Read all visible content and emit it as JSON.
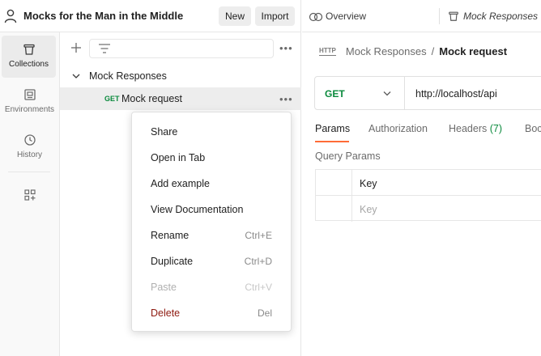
{
  "workspace": {
    "title": "Mocks for the Man in the Middle",
    "new_label": "New",
    "import_label": "Import"
  },
  "rail": {
    "items": [
      {
        "label": "Collections",
        "icon": "trash-can-icon",
        "active": true
      },
      {
        "label": "Environments",
        "icon": "environment-icon",
        "active": false
      },
      {
        "label": "History",
        "icon": "history-icon",
        "active": false
      },
      {
        "label": "",
        "icon": "apps-add-icon",
        "active": false
      }
    ]
  },
  "tree": {
    "more": "•••",
    "folder": {
      "label": "Mock Responses"
    },
    "request": {
      "method": "GET",
      "label": "Mock request",
      "more": "•••"
    }
  },
  "context_menu": {
    "items": [
      {
        "label": "Share",
        "shortcut": "",
        "state": "normal"
      },
      {
        "label": "Open in Tab",
        "shortcut": "",
        "state": "normal"
      },
      {
        "label": "Add example",
        "shortcut": "",
        "state": "normal"
      },
      {
        "label": "View Documentation",
        "shortcut": "",
        "state": "normal"
      },
      {
        "label": "Rename",
        "shortcut": "Ctrl+E",
        "state": "normal"
      },
      {
        "label": "Duplicate",
        "shortcut": "Ctrl+D",
        "state": "normal"
      },
      {
        "label": "Paste",
        "shortcut": "Ctrl+V",
        "state": "disabled"
      },
      {
        "label": "Delete",
        "shortcut": "Del",
        "state": "danger"
      }
    ]
  },
  "right": {
    "tabs": {
      "overview": "Overview",
      "mock": "Mock Responses"
    },
    "breadcrumb": {
      "badge": "HTTP",
      "parent": "Mock Responses",
      "separator": "/",
      "current": "Mock request"
    },
    "request": {
      "method": "GET",
      "url": "http://localhost/api"
    },
    "req_tabs": {
      "params": "Params",
      "authorization": "Authorization",
      "headers": "Headers",
      "headers_count": "(7)",
      "body": "Boc"
    },
    "query_params": {
      "title": "Query Params",
      "header_key": "Key",
      "placeholder_key": "Key"
    }
  },
  "colors": {
    "accent": "#ff6c37",
    "get_method": "#0b8a3d",
    "danger": "#8e1a10"
  }
}
